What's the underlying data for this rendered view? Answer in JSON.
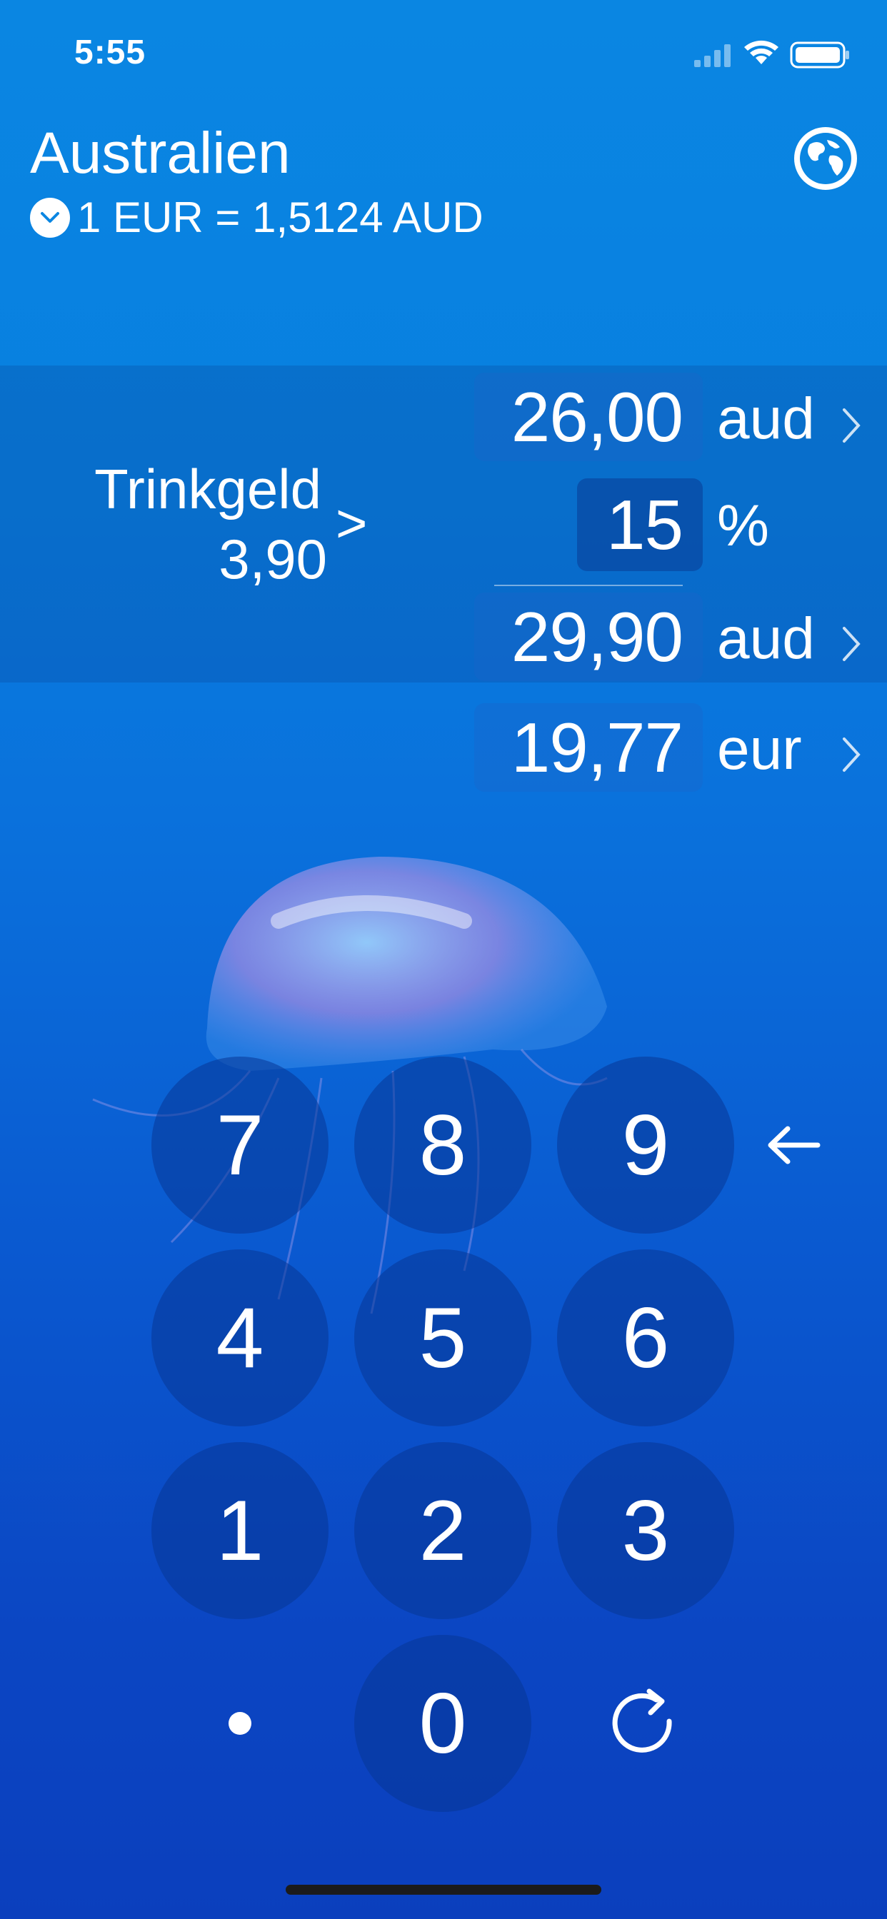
{
  "status_bar": {
    "time": "5:55"
  },
  "header": {
    "country": "Australien",
    "rate": "1 EUR = 1,5124 AUD"
  },
  "tip": {
    "label": "Trinkgeld",
    "amount": "3,90",
    "chevron": ">"
  },
  "amount": {
    "value": "26,00",
    "unit": "aud"
  },
  "percent": {
    "value": "15",
    "unit": "%"
  },
  "total": {
    "value": "29,90",
    "unit": "aud"
  },
  "converted": {
    "value": "19,77",
    "unit": "eur"
  },
  "keypad": {
    "k7": "7",
    "k8": "8",
    "k9": "9",
    "k4": "4",
    "k5": "5",
    "k6": "6",
    "k1": "1",
    "k2": "2",
    "k3": "3",
    "k0": "0"
  },
  "icons": {
    "backspace": "arrow-left-icon",
    "refresh": "refresh-icon",
    "globe": "globe-icon",
    "chevron": "chevron-down-icon"
  },
  "colors": {
    "background": "#0a86e2",
    "keypad": "#0a3a9a",
    "accent": "#ffffff"
  }
}
